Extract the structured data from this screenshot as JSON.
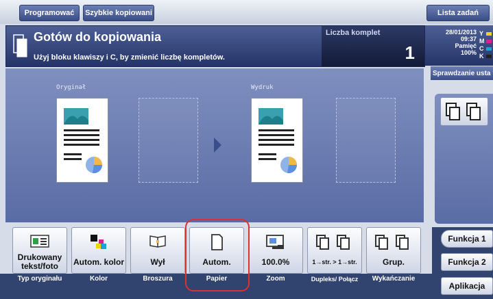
{
  "topbar": {
    "tab1": "Programować",
    "tab2": "Szybkie kopiowani",
    "jobs": "Lista zadań"
  },
  "header": {
    "title": "Gotów do kopiowania",
    "subtitle": "Użyj bloku klawiszy i C, by zmienić liczbę kompletów.",
    "count_label": "Liczba komplet",
    "count_value": "1"
  },
  "status": {
    "date": "28/01/2013",
    "time": "09:37",
    "memory_label": "Pamięć",
    "memory_value": "100%",
    "toner": [
      {
        "letter": "Y",
        "color": "#f2d21b"
      },
      {
        "letter": "M",
        "color": "#d6238f"
      },
      {
        "letter": "C",
        "color": "#1aa3d9"
      },
      {
        "letter": "K",
        "color": "#222222"
      }
    ],
    "check_button": "Sprawdzanie usta"
  },
  "preview": {
    "original_label": "Oryginał",
    "output_label": "Wydruk"
  },
  "functions": [
    {
      "text": "Drukowany tekst/foto",
      "label": "Typ oryginału"
    },
    {
      "text": "Autom. kolor",
      "label": "Kolor"
    },
    {
      "text": "Wył",
      "label": "Broszura"
    },
    {
      "text": "Autom.",
      "label": "Papier"
    },
    {
      "text": "100.0%",
      "label": "Zoom"
    },
    {
      "text": "1→str. > 1→str.",
      "label": "Dupleks/ Połącz"
    },
    {
      "text": "Grup.",
      "label": "Wykańczanie"
    }
  ],
  "side": {
    "func1": "Funkcja 1",
    "func2": "Funkcja 2",
    "app": "Aplikacja"
  },
  "colors": {
    "header": "#2f3f75",
    "highlight": "#d93232",
    "accent": "#3b4e8c"
  }
}
